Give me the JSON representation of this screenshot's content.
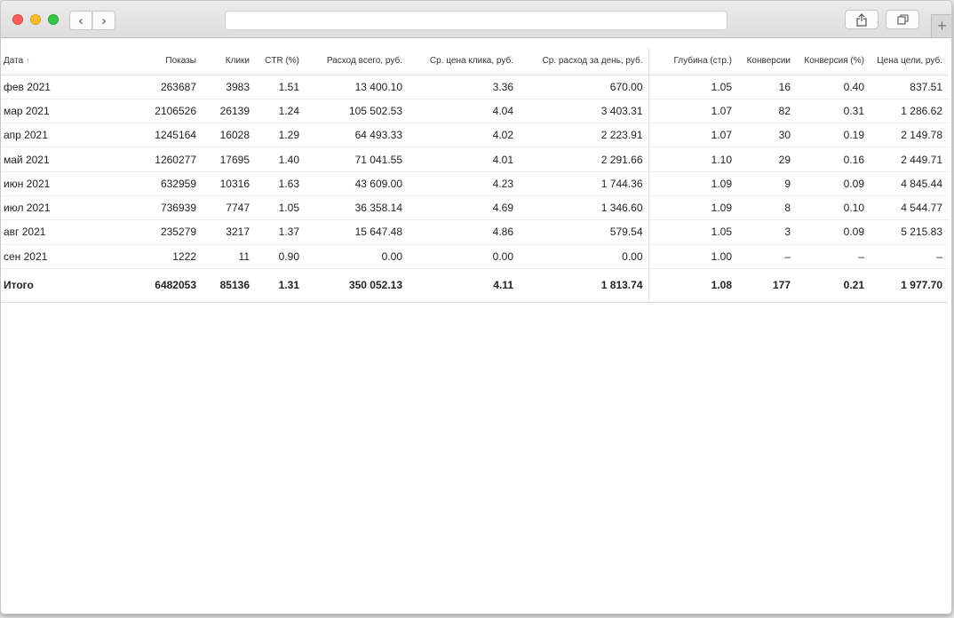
{
  "toolbar": {
    "back_icon": "chevron-left-icon",
    "forward_icon": "chevron-right-icon",
    "back_glyph": "‹",
    "forward_glyph": "›",
    "new_tab_glyph": "+"
  },
  "report": {
    "date_header": "Дата",
    "sort_arrow": "↑",
    "columns": [
      "Показы",
      "Клики",
      "CTR (%)",
      "Расход всего, руб.",
      "Ср. цена клика, руб.",
      "Ср. расход за день, руб.",
      "Глубина (стр.)",
      "Конверсии",
      "Конверсия (%)",
      "Цена цели, руб."
    ],
    "rows": [
      [
        "фев 2021",
        "263687",
        "3983",
        "1.51",
        "13 400.10",
        "3.36",
        "670.00",
        "1.05",
        "16",
        "0.40",
        "837.51"
      ],
      [
        "мар 2021",
        "2106526",
        "26139",
        "1.24",
        "105 502.53",
        "4.04",
        "3 403.31",
        "1.07",
        "82",
        "0.31",
        "1 286.62"
      ],
      [
        "апр 2021",
        "1245164",
        "16028",
        "1.29",
        "64 493.33",
        "4.02",
        "2 223.91",
        "1.07",
        "30",
        "0.19",
        "2 149.78"
      ],
      [
        "май 2021",
        "1260277",
        "17695",
        "1.40",
        "71 041.55",
        "4.01",
        "2 291.66",
        "1.10",
        "29",
        "0.16",
        "2 449.71"
      ],
      [
        "июн 2021",
        "632959",
        "10316",
        "1.63",
        "43 609.00",
        "4.23",
        "1 744.36",
        "1.09",
        "9",
        "0.09",
        "4 845.44"
      ],
      [
        "июл 2021",
        "736939",
        "7747",
        "1.05",
        "36 358.14",
        "4.69",
        "1 346.60",
        "1.09",
        "8",
        "0.10",
        "4 544.77"
      ],
      [
        "авг 2021",
        "235279",
        "3217",
        "1.37",
        "15 647.48",
        "4.86",
        "579.54",
        "1.05",
        "3",
        "0.09",
        "5 215.83"
      ],
      [
        "сен 2021",
        "1222",
        "11",
        "0.90",
        "0.00",
        "0.00",
        "0.00",
        "1.00",
        "–",
        "–",
        "–"
      ]
    ],
    "total": [
      "Итого",
      "6482053",
      "85136",
      "1.31",
      "350 052.13",
      "4.11",
      "1 813.74",
      "1.08",
      "177",
      "0.21",
      "1 977.70"
    ]
  }
}
